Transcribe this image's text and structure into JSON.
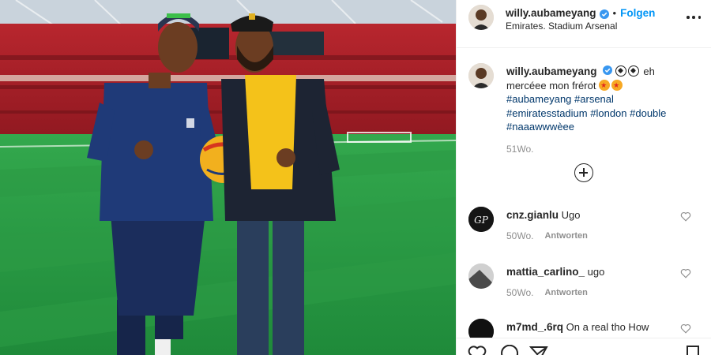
{
  "post": {
    "username": "willy.aubameyang",
    "follow_label": "Folgen",
    "separator": "•",
    "location": "Emirates. Stadium Arsenal"
  },
  "caption": {
    "username": "willy.aubameyang",
    "text": "eh mercéee mon frérot",
    "hashtags": [
      "#aubameyang",
      "#arsenal",
      "#emiratesstadium",
      "#london",
      "#double",
      "#naaawwwèee"
    ],
    "time_ago": "51Wo."
  },
  "comments": [
    {
      "username": "cnz.gianlu",
      "text": "Ugo",
      "time_ago": "50Wo.",
      "reply_label": "Antworten"
    },
    {
      "username": "mattia_carlino_",
      "text": "ugo",
      "time_ago": "50Wo.",
      "reply_label": "Antworten"
    },
    {
      "username": "m7md_.6rq",
      "text": "On a real tho How"
    }
  ],
  "icons": {
    "more": "more-options-icon",
    "verified": "verified-badge-icon",
    "load_more": "plus-circle-icon",
    "like": "heart-icon",
    "comment": "comment-bubble-icon",
    "share": "paper-plane-icon",
    "save": "bookmark-icon"
  },
  "colors": {
    "accent": "#0095f6",
    "hashtag": "#00376b",
    "muted": "#8e8e8e",
    "text": "#262626"
  }
}
